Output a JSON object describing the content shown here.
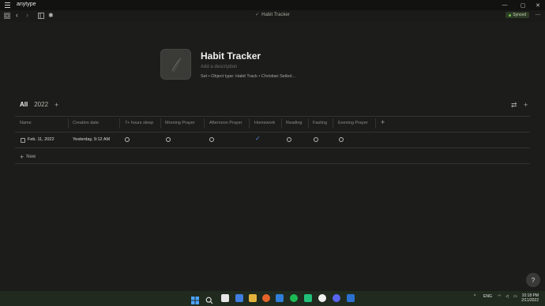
{
  "app": {
    "name": "anytype"
  },
  "toolbar": {
    "breadcrumb": "Habit Tracker",
    "sync_status": "Synced"
  },
  "header": {
    "title": "Habit Tracker",
    "description_placeholder": "Add a description",
    "meta": "Set  •  Object type: Habit Track  •  Christian Seibol..."
  },
  "views": {
    "tabs": [
      {
        "label": "All",
        "active": true
      },
      {
        "label": "2022",
        "active": false
      }
    ],
    "add_label": "+"
  },
  "table": {
    "columns": [
      "Name",
      "Creation date",
      "7+ hours sleep",
      "Morning Prayer",
      "Afternoon Prayer",
      "Homework",
      "Reading",
      "Fasting",
      "Evening Prayer"
    ],
    "rows": [
      {
        "name": "Feb. 11, 2022",
        "creation_date": "Yesterday, 9:12 AM",
        "habits": {
          "7+ hours sleep": false,
          "Morning Prayer": false,
          "Afternoon Prayer": false,
          "Homework": true,
          "Reading": false,
          "Fasting": false,
          "Evening Prayer": false
        }
      }
    ],
    "new_row_label": "New"
  },
  "help": {
    "label": "?"
  },
  "taskbar": {
    "language": "ENG",
    "time": "10:18 PM",
    "date": "2/11/2022"
  },
  "colors": {
    "background": "#1c1c1a",
    "checked": "#4f8ddb",
    "synced_badge": "#2d3b26"
  }
}
